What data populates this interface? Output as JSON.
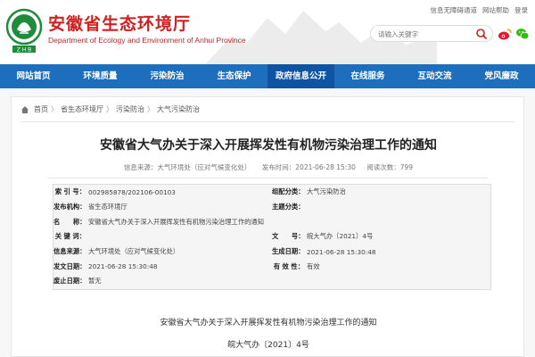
{
  "header": {
    "title": "安徽省生态环境厅",
    "subtitle": "Department of Ecology and Environment of Anhui Province",
    "top_links": [
      "信息无障碍通道",
      "网站帮助",
      "登录"
    ],
    "search_placeholder": "请输入关键字"
  },
  "nav": {
    "items": [
      "网站首页",
      "环境质量",
      "污染防治",
      "生态保护",
      "政府信息公开",
      "在线服务",
      "互动交流",
      "党风廉政"
    ],
    "active_index": 4
  },
  "breadcrumb": [
    "首页",
    "省生态环境厅",
    "污染防治",
    "大气污染防治"
  ],
  "article": {
    "title": "安徽省大气办关于深入开展挥发性有机物污染治理工作的通知",
    "source": "信息来源：大气环境处（应对气候变化处）",
    "date": "发布时间：2021-06-28 15:30",
    "views": "阅读次数：799"
  },
  "info_table": [
    [
      {
        "label": "索 引 号：",
        "value": "002985878/202106-00103"
      },
      {
        "label": "组配分类：",
        "value": "大气污染防治"
      }
    ],
    [
      {
        "label": "发布机构：",
        "value": "省生态环境厅"
      },
      {
        "label": "主题分类：",
        "value": ""
      }
    ],
    [
      {
        "label": "名　　称：",
        "value": "安徽省大气办关于深入开展挥发性有机物污染治理工作的通知"
      },
      {
        "label": "",
        "value": ""
      }
    ],
    [
      {
        "label": "关 键 词：",
        "value": ""
      },
      {
        "label": "文　　号：",
        "value": "皖大气办〔2021〕4号"
      }
    ],
    [
      {
        "label": "信息来源：",
        "value": "大气环境处（应对气候变化处）"
      },
      {
        "label": "生成日期：",
        "value": "2021-06-28 15:30:48"
      }
    ],
    [
      {
        "label": "发文日期：",
        "value": "2021-06-28 15:30:48"
      },
      {
        "label": "有 效 性：",
        "value": "有效"
      }
    ],
    [
      {
        "label": "废止日期：",
        "value": "暂无"
      },
      {
        "label": "",
        "value": ""
      }
    ]
  ],
  "body": {
    "line1": "安徽省大气办关于深入开展挥发性有机物污染治理工作的通知",
    "line2": "皖大气办〔2021〕4号"
  },
  "colors": {
    "brand_red": "#d51f1f",
    "nav_blue": "#1d6fbe",
    "nav_active": "#0e54a3",
    "logo_green": "#1e8c3a"
  }
}
